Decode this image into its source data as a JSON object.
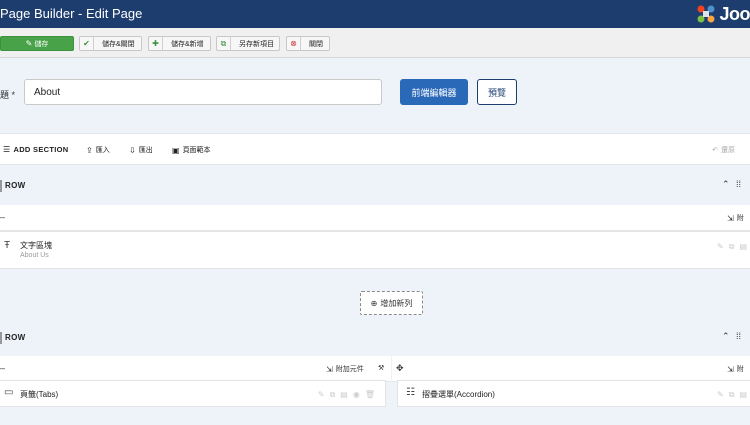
{
  "header": {
    "title": "Page Builder - Edit Page",
    "logo_text": "Joo"
  },
  "toolbar": {
    "save": "儲存",
    "save_close": "儲存&關閉",
    "save_new": "儲存&新增",
    "save_copy": "另存新項目",
    "close": "關閉"
  },
  "title_field": {
    "label": "題 *",
    "value": "About"
  },
  "buttons": {
    "frontend_editor": "前端編輯器",
    "preview": "預覽"
  },
  "actions": {
    "add_section": "ADD SECTION",
    "import": "匯入",
    "export": "匯出",
    "page_template": "頁面範本",
    "undo": "還原"
  },
  "rows": [
    {
      "label": "ROW",
      "attach": "附",
      "addon": {
        "name": "文字區塊",
        "subtitle": "About Us"
      }
    },
    {
      "label": "ROW",
      "attach_left": "附加元件",
      "attach_right": "附",
      "addons": [
        {
          "name": "頁籤(Tabs)"
        },
        {
          "name": "摺疊選單(Accordion)"
        }
      ]
    }
  ],
  "add_row": "增加新列",
  "icons": {
    "save": "edit-icon",
    "save_close": "check-icon",
    "save_new": "plus-icon",
    "save_copy": "copy-icon",
    "close": "close-circle-icon",
    "text_block": "text-icon",
    "tabs": "tabs-icon",
    "accordion": "list-icon"
  },
  "colors": {
    "header_bg": "#1c3d6e",
    "primary": "#2a69b8",
    "save_green": "#48a248",
    "bg_light": "#eef3fa"
  }
}
